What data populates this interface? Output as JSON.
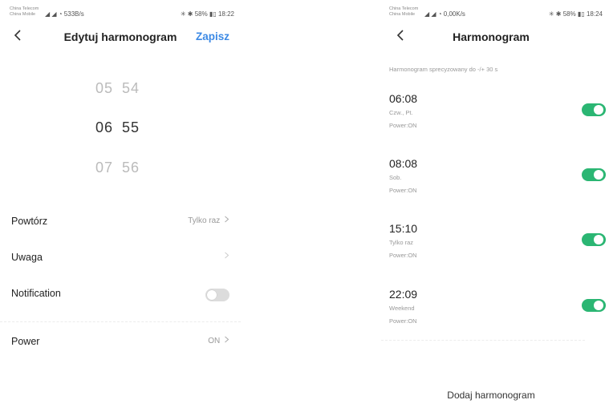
{
  "left": {
    "status": {
      "carrier_line1": "China Telecom",
      "carrier_line2": "China Mobile",
      "signal": "◢ ◢ ◔ 533B/s",
      "right": "✳ ✱ 58% ▮▯ 18:22"
    },
    "title": "Edytuj harmonogram",
    "save_label": "Zapisz",
    "picker": {
      "above": {
        "hh": "05",
        "mm": "54"
      },
      "selected": {
        "hh": "06",
        "mm": "55"
      },
      "below": {
        "hh": "07",
        "mm": "56"
      }
    },
    "rows": {
      "repeat": {
        "label": "Powtórz",
        "value": "Tylko raz"
      },
      "note": {
        "label": "Uwaga",
        "value": ""
      },
      "notification": {
        "label": "Notification",
        "enabled": false
      },
      "power": {
        "label": "Power",
        "value": "ON"
      }
    }
  },
  "right": {
    "status": {
      "carrier_line1": "China Telecom",
      "carrier_line2": "China Mobile",
      "signal": "◢ ◢ ◔ 0,00K/s",
      "right": "✳ ✱ 58% ▮▯ 18:24"
    },
    "title": "Harmonogram",
    "note": "Harmonogram sprecyzowany do -/+ 30 s",
    "schedules": [
      {
        "time": "06:08",
        "days": "Czw., Pt.",
        "power": "Power:ON",
        "enabled": true
      },
      {
        "time": "08:08",
        "days": "Sob.",
        "power": "Power:ON",
        "enabled": true
      },
      {
        "time": "15:10",
        "days": "Tylko raz",
        "power": "Power:ON",
        "enabled": true
      },
      {
        "time": "22:09",
        "days": "Weekend",
        "power": "Power:ON",
        "enabled": true
      }
    ],
    "add_label": "Dodaj harmonogram"
  },
  "colors": {
    "accent": "#3d8ae5",
    "toggle_on": "#2bb673",
    "toggle_off": "#dcdcdc"
  },
  "icons": {
    "back": "chevron-left-icon",
    "row_arrow": "chevron-right-icon"
  }
}
